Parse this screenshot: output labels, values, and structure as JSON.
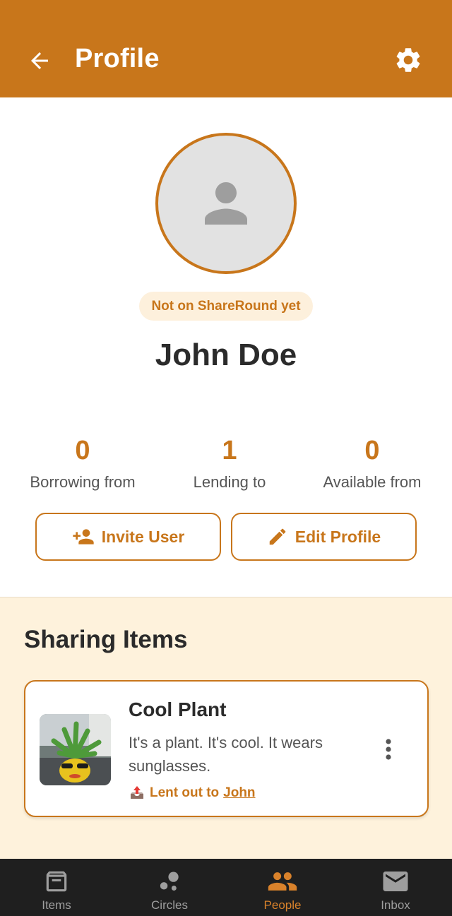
{
  "appbar": {
    "title": "Profile",
    "back_icon": "arrow-back-icon",
    "settings_icon": "gear-icon"
  },
  "profile": {
    "avatar_icon": "person-icon",
    "badge": "Not on ShareRound yet",
    "name": "John Doe"
  },
  "stats": [
    {
      "value": "0",
      "label": "Borrowing from"
    },
    {
      "value": "1",
      "label": "Lending to"
    },
    {
      "value": "0",
      "label": "Available from"
    }
  ],
  "actions": {
    "invite_label": "Invite User",
    "invite_icon": "person-add-icon",
    "edit_label": "Edit Profile",
    "edit_icon": "pencil-icon"
  },
  "sharing": {
    "heading": "Sharing Items",
    "items": [
      {
        "title": "Cool Plant",
        "description": "It's a plant. It's cool. It wears sunglasses.",
        "status_prefix": "Lent out to",
        "status_user": "John",
        "status_icon": "outbox-tray-icon",
        "menu_icon": "more-vert-icon"
      }
    ]
  },
  "nav": {
    "items": [
      {
        "label": "Items",
        "icon": "archive-box-icon",
        "active": false
      },
      {
        "label": "Circles",
        "icon": "bubbles-icon",
        "active": false
      },
      {
        "label": "People",
        "icon": "people-icon",
        "active": true
      },
      {
        "label": "Inbox",
        "icon": "mail-icon",
        "active": false
      }
    ]
  },
  "colors": {
    "accent": "#c8761b",
    "badge_bg": "#fdf0dc",
    "section_bg": "#fef2dc",
    "nav_bg": "#1f1f1f",
    "nav_active": "#d9822b",
    "nav_inactive": "#9e9e9e"
  }
}
